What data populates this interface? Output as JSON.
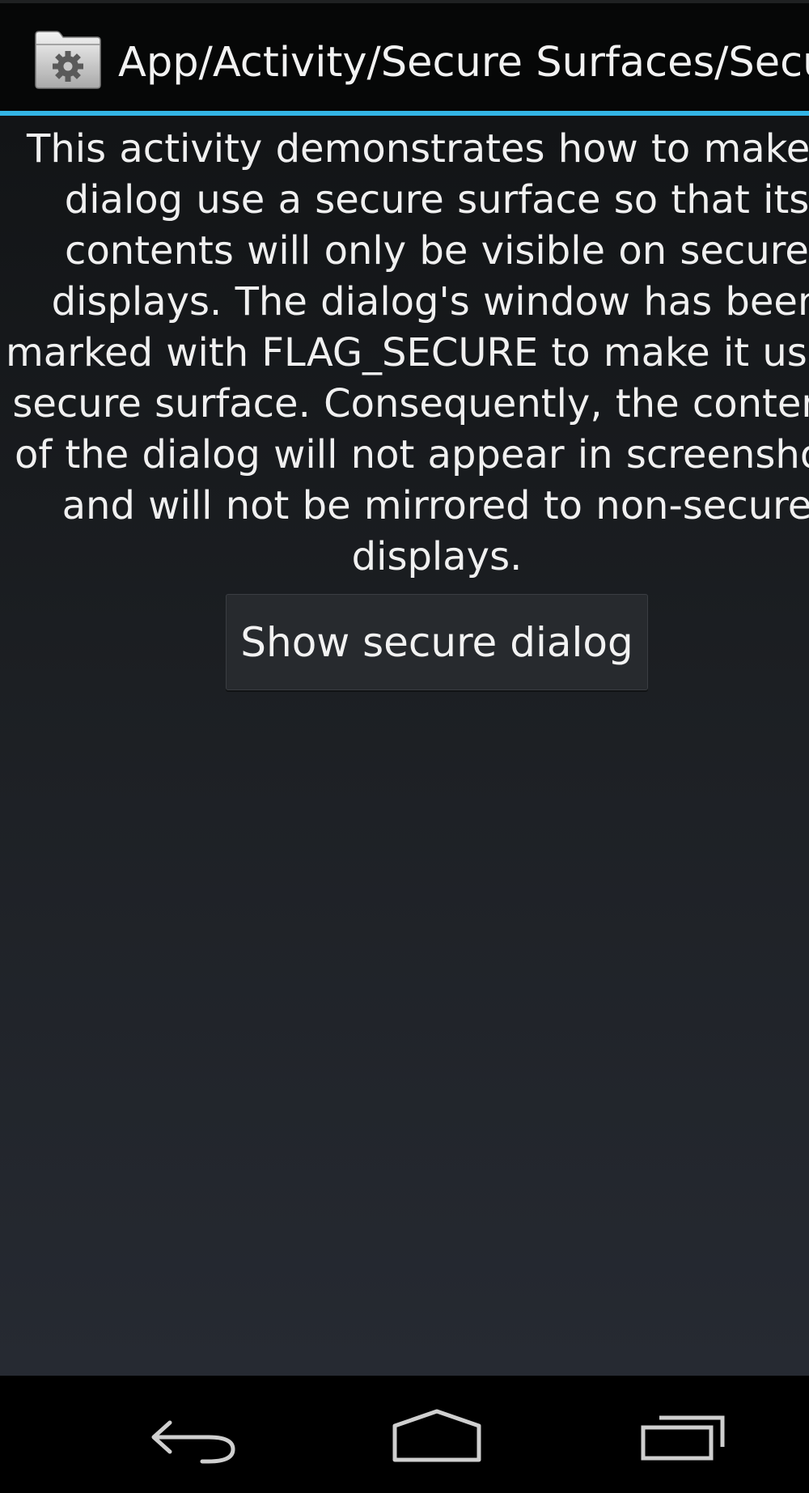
{
  "action_bar": {
    "title": "App/Activity/Secure Surfaces/Secure Dialog",
    "icon": "folder-gear-icon"
  },
  "content": {
    "description_lines": [
      "This activity demonstrates how to make a",
      "dialog use a secure surface so that its",
      "contents will only be visible on secure",
      "displays. The dialog's window has been",
      "marked with FLAG_SECURE to make it use a",
      "secure surface. Consequently, the contents",
      "of the dialog will not appear in screenshots",
      "and will not be mirrored to non-secure",
      "displays."
    ],
    "button_label": "Show secure dialog"
  },
  "nav_bar": {
    "back_icon": "back-arrow-icon",
    "home_icon": "home-icon",
    "recents_icon": "recent-apps-icon"
  },
  "colors": {
    "accent": "#33b5e5",
    "action_bar_bg": "#060707",
    "content_bg_top": "#121416",
    "content_bg_bottom": "#262a32",
    "button_bg": "#272a2e"
  }
}
